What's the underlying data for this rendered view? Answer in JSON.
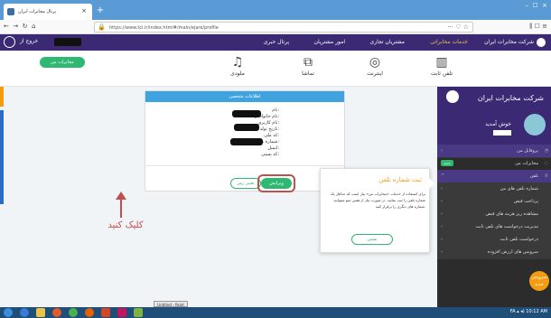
{
  "browser": {
    "tab_title": "پرتال مخابرات ایران",
    "url": "https://www.tci.ir/index.html#/main/ejare/profile",
    "right_icons": "··· ♡ ☆",
    "nav_right": "⫼ ☐ ≡"
  },
  "header": {
    "logo": "شرکت مخابرات ایران",
    "menu": [
      "خدمات مخابراتی",
      "مشتریان تجاری",
      "امور مشتریان",
      "پرتال خبری"
    ],
    "exit": "خروج از"
  },
  "submenu": {
    "items": [
      {
        "label": "تلفن ثابت",
        "icon": "phone-icon"
      },
      {
        "label": "اینترنت",
        "icon": "globe-icon"
      },
      {
        "label": "تماشا",
        "icon": "tv-icon"
      },
      {
        "label": "ملودی",
        "icon": "music-icon"
      }
    ],
    "green_button": "مخابرات من"
  },
  "sidebar": {
    "brand": "شرکت مخابرات ایران",
    "welcome": "خوش آمدید",
    "items": [
      {
        "label": "پروفایل من",
        "badge": ""
      },
      {
        "label": "مخابرات من",
        "badge": "جدید"
      },
      {
        "label": "تلفن",
        "badge": ""
      },
      {
        "label": "شماره تلفن های من",
        "badge": ""
      },
      {
        "label": "پرداخت قبض",
        "badge": ""
      },
      {
        "label": "مشاهده ریز هزینه های قبض",
        "badge": ""
      },
      {
        "label": "مدیریت درخواست های تلفن ثابت",
        "badge": ""
      },
      {
        "label": "درخواست تلفن ثابت",
        "badge": ""
      },
      {
        "label": "سرویس های ارزش افزوده",
        "badge": ""
      }
    ],
    "new_service": "سرویس جدید"
  },
  "card": {
    "title": "اطلاعات شخصی",
    "fields": [
      "نام:",
      "نام خانوادگی:",
      "نام کاربری:",
      "تاریخ تولد:",
      "کد ملی:",
      "شماره موبایل:",
      "ایمیل:",
      "کد پستی:"
    ],
    "edit": "ویرایش",
    "change_password": "تغییر رمز"
  },
  "annotation": {
    "click_here": "کلیک کنید"
  },
  "popup": {
    "title": "ثبت شماره تلفن",
    "body": "برای استفاده از خدمات «مخابرات من» نیاز است که حداقل یک شماره تلفن را ثبت نمایید. در صورت نیاز از همین منو میتوانید شماره های دیگری را برقرار کنید.",
    "button": "بستن"
  },
  "taskbar": {
    "untitled": "Untitled - Paint",
    "tray": "FA ▴ ◂) 10:12 AM"
  },
  "colors": {
    "brand": "#3b2a73",
    "accent_green": "#2eb872",
    "highlight_red": "#c0504d",
    "header_blue": "#3fa3e0"
  }
}
